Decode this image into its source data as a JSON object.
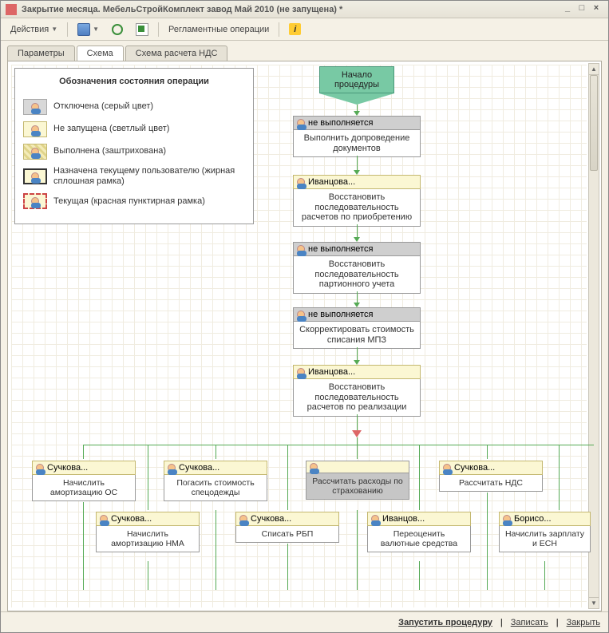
{
  "window": {
    "title": "Закрытие месяца. МебельСтройКомплект завод Май 2010 (не запущена) *"
  },
  "toolbar": {
    "actions": "Действия",
    "reglament": "Регламентные операции"
  },
  "tabs": {
    "params": "Параметры",
    "scheme": "Схема",
    "vat": "Схема расчета НДС"
  },
  "legend": {
    "title": "Обозначения состояния операции",
    "off": "Отключена (серый цвет)",
    "nostart": "Не запущена (светлый цвет)",
    "done": "Выполнена (заштрихована)",
    "assigned": "Назначена текущему пользователю (жирная сплошная рамка)",
    "current": "Текущая (красная пунктирная рамка)"
  },
  "start": "Начало процедуры",
  "nodes": {
    "n1_user": "не выполняется",
    "n1_text": "Выполнить допроведение документов",
    "n2_user": "Иванцова...",
    "n2_text": "Восстановить последовательность расчетов по приобретению",
    "n3_user": "не выполняется",
    "n3_text": "Восстановить последовательность партионного учета",
    "n4_user": "не выполняется",
    "n4_text": "Скорректировать стоимость списания МПЗ",
    "n5_user": "Иванцова...",
    "n5_text": "Восстановить последовательность расчетов по реализации"
  },
  "branch": {
    "b1_user": "Сучкова...",
    "b1_text": "Начислить амортизацию ОС",
    "b2_user": "Сучкова...",
    "b2_text": "Погасить стоимость спецодежды",
    "b3_user": "",
    "b3_text": "Рассчитать расходы по страхованию",
    "b4_user": "Сучкова...",
    "b4_text": "Рассчитать НДС",
    "c1_user": "Сучкова...",
    "c1_text": "Начислить амортизацию НМА",
    "c2_user": "Сучкова...",
    "c2_text": "Списать РБП",
    "c3_user": "Иванцов...",
    "c3_text": "Переоценить валютные средства",
    "c4_user": "Борисо...",
    "c4_text": "Начислить зарплату и ЕСН"
  },
  "footer": {
    "run": "Запустить процедуру",
    "save": "Записать",
    "close": "Закрыть"
  }
}
